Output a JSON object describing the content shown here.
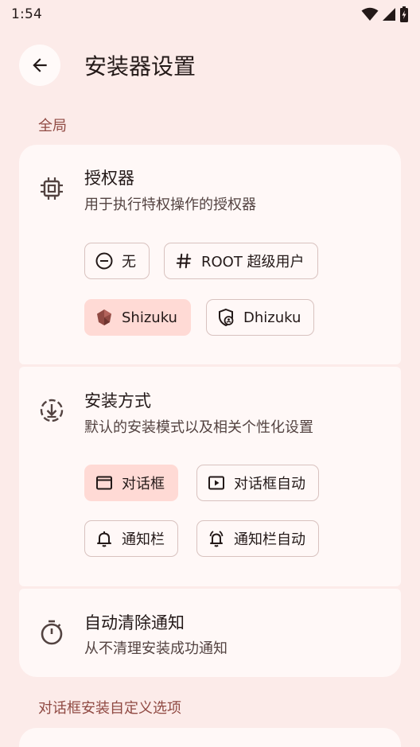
{
  "status_bar": {
    "time": "1:54"
  },
  "app_bar": {
    "title": "安装器设置"
  },
  "sections": {
    "global": "全局",
    "dialog_custom": "对话框安装自定义选项"
  },
  "authorizer": {
    "title": "授权器",
    "subtitle": "用于执行特权操作的授权器",
    "options": [
      "无",
      "ROOT 超级用户",
      "Shizuku",
      "Dhizuku"
    ],
    "selected": "Shizuku"
  },
  "install_method": {
    "title": "安装方式",
    "subtitle": "默认的安装模式以及相关个性化设置",
    "options": [
      "对话框",
      "对话框自动",
      "通知栏",
      "通知栏自动"
    ],
    "selected": "对话框"
  },
  "auto_clear": {
    "title": "自动清除通知",
    "subtitle": "从不清理安装成功通知"
  },
  "colors": {
    "background": "#fcebe9",
    "card": "#fff8f7",
    "accent": "#904a43",
    "selected_chip": "#ffdad5"
  }
}
